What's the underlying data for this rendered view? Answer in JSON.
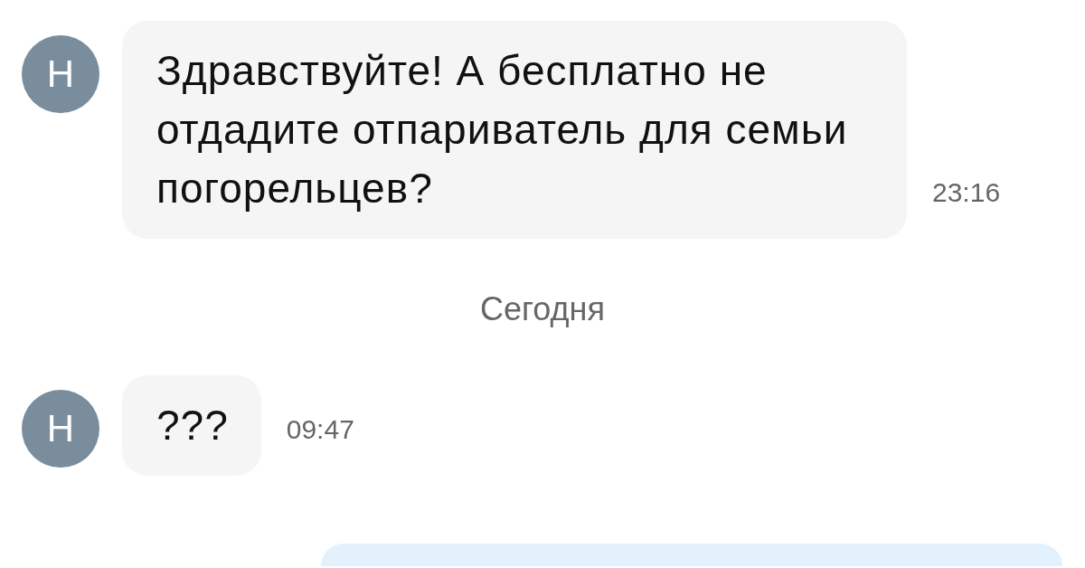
{
  "chat": {
    "items": [
      {
        "kind": "incoming_message",
        "avatar": "Н",
        "text": "Здравствуйте! А бесплатно не отдадите отпариватель для семьи погорельцев?",
        "time": "23:16"
      },
      {
        "kind": "date_divider",
        "label": "Сегодня"
      },
      {
        "kind": "incoming_message",
        "avatar": "Н",
        "text": "???",
        "time": "09:47"
      },
      {
        "kind": "outgoing_message"
      }
    ]
  }
}
